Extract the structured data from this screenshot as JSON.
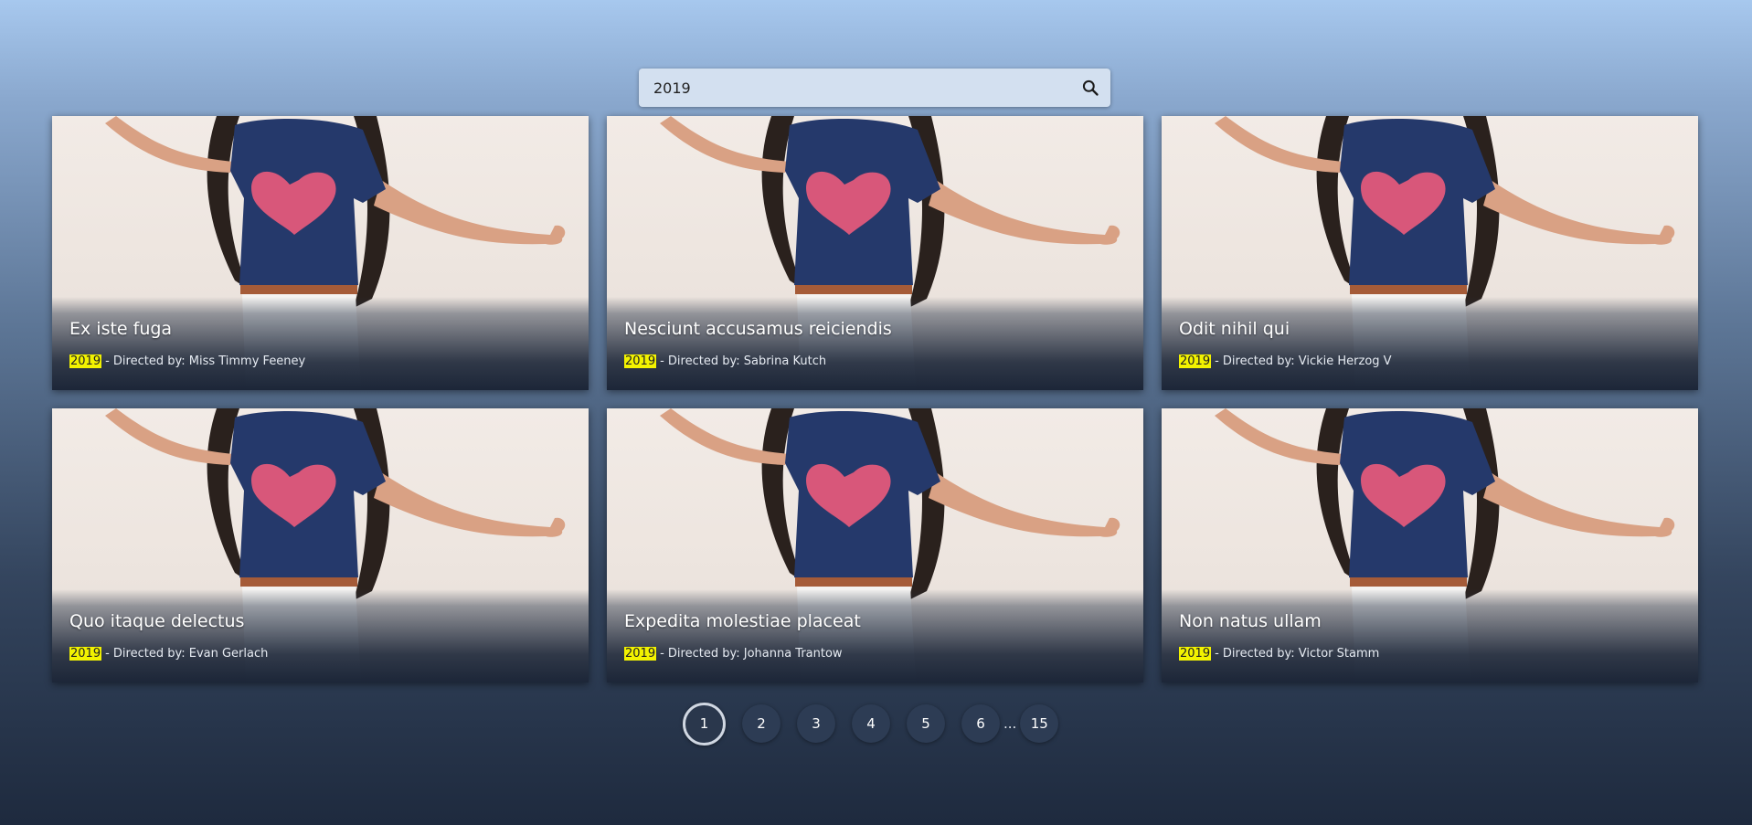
{
  "search": {
    "value": "2019",
    "icon": "search-icon"
  },
  "cards": [
    {
      "title": "Ex iste fuga",
      "year": "2019",
      "meta": "- Directed by: Miss Timmy Feeney"
    },
    {
      "title": "Nesciunt accusamus reiciendis",
      "year": "2019",
      "meta": "- Directed by: Sabrina Kutch"
    },
    {
      "title": "Odit nihil qui",
      "year": "2019",
      "meta": "- Directed by: Vickie Herzog V"
    },
    {
      "title": "Quo itaque delectus",
      "year": "2019",
      "meta": "- Directed by: Evan Gerlach"
    },
    {
      "title": "Expedita molestiae placeat",
      "year": "2019",
      "meta": "- Directed by: Johanna Trantow"
    },
    {
      "title": "Non natus ullam",
      "year": "2019",
      "meta": "- Directed by: Victor Stamm"
    }
  ],
  "pagination": {
    "pages": [
      "1",
      "2",
      "3",
      "4",
      "5",
      "6"
    ],
    "ellipsis": "...",
    "last": "15",
    "current": "1"
  },
  "colors": {
    "highlight": "#f2f200",
    "page_button": "#2d3c54"
  }
}
